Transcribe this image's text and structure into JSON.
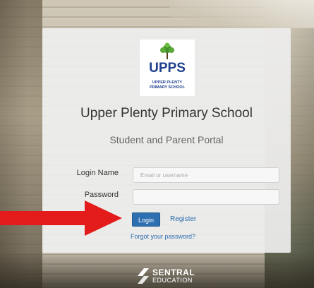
{
  "logo": {
    "word": "UPPS",
    "subtitle_line1": "UPPER PLENTY",
    "subtitle_line2": "PRIMARY SCHOOL"
  },
  "header": {
    "school_name": "Upper Plenty Primary School",
    "portal_title": "Student and Parent Portal"
  },
  "form": {
    "login_label": "Login Name",
    "login_placeholder": "Email or username",
    "login_value": "",
    "password_label": "Password",
    "password_value": "",
    "login_button": "Login",
    "register_link": "Register",
    "forgot_link": "Forgot your password?"
  },
  "footer": {
    "brand_name": "SENTRAL",
    "brand_sub": "EDUCATION"
  },
  "colors": {
    "accent": "#2d6fb0",
    "arrow": "#e31b1b",
    "logo_blue": "#1e3f8c",
    "logo_red": "#c0392b"
  }
}
